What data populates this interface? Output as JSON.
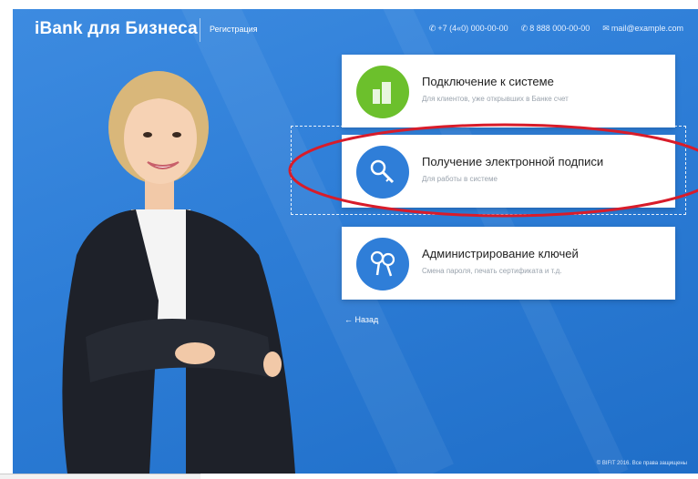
{
  "header": {
    "brand": "iBank для Бизнеса",
    "register_link": "Регистрация",
    "phone1": "+7 (4«0) 000-00-00",
    "phone2": "8 888 000-00-00",
    "email": "mail@example.com"
  },
  "cards": [
    {
      "title": "Подключение к системе",
      "subtitle": "Для клиентов, уже открывших в Банке счет",
      "icon": "building-icon",
      "color": "#6cc02c"
    },
    {
      "title": "Получение электронной подписи",
      "subtitle": "Для работы в системе",
      "icon": "key-icon",
      "color": "#2f7ed8"
    },
    {
      "title": "Администрирование ключей",
      "subtitle": "Смена пароля, печать сертификата и т.д.",
      "icon": "keys-icon",
      "color": "#2f7ed8"
    }
  ],
  "back_label": "← Назад",
  "footer": "© BIFIT 2016. Все права защищены",
  "colors": {
    "background": "#2f7fd8",
    "highlight": "#d81c2a",
    "green": "#6cc02c",
    "blue": "#2f7ed8"
  }
}
